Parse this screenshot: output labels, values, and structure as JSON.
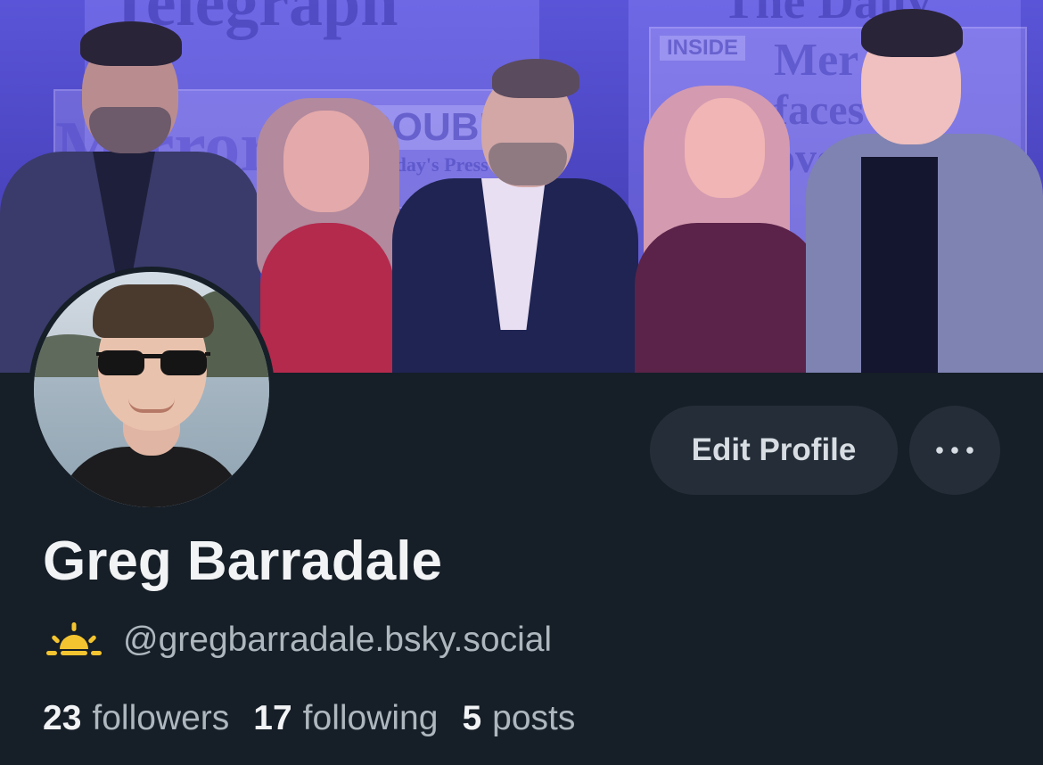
{
  "profile": {
    "display_name": "Greg Barradale",
    "handle": "@gregbarradale.bsky.social",
    "handle_icon": "sunrise-icon",
    "stats": {
      "followers_count": "23",
      "followers_label": "followers",
      "following_count": "17",
      "following_label": "following",
      "posts_count": "5",
      "posts_label": "posts"
    }
  },
  "actions": {
    "edit_profile_label": "Edit Profile",
    "more_icon": "more-horizontal-icon"
  },
  "banner": {
    "mastheads": [
      "Telegraph",
      "The Daily",
      "Mirror"
    ],
    "headlines": [
      "DOUBLE",
      "INSIDE",
      "Mer",
      "faces",
      "over",
      "Today's Press"
    ]
  },
  "colors": {
    "background": "#161e27",
    "button_bg": "#252e38",
    "text_primary": "#f1f3f5",
    "text_secondary": "#aeb6be",
    "sun_yellow": "#f4c430"
  }
}
